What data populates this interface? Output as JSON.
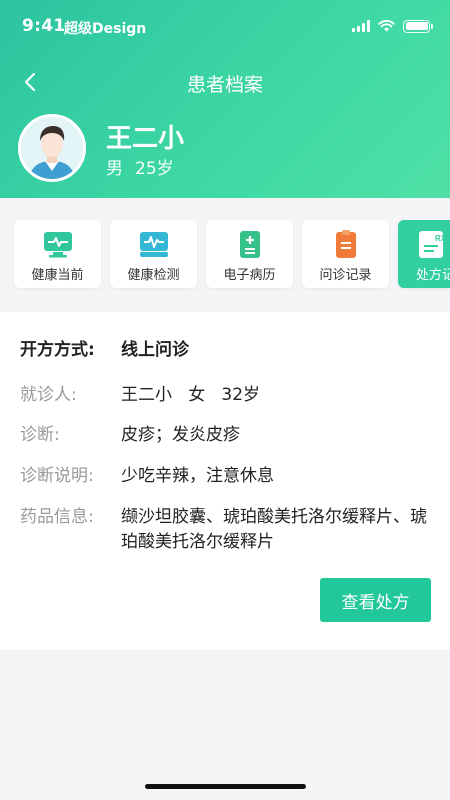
{
  "status_bar": {
    "time": "9:41",
    "carrier": "超级Design"
  },
  "nav": {
    "title": "患者档案"
  },
  "patient": {
    "name": "王二小",
    "gender": "男",
    "age": "25岁"
  },
  "quick_actions": [
    {
      "label": "健康当前",
      "icon": "monitor-heartbeat-icon",
      "color": "#2fc79b"
    },
    {
      "label": "健康检测",
      "icon": "pulse-screen-icon",
      "color": "#33b7d4"
    },
    {
      "label": "电子病历",
      "icon": "medical-record-icon",
      "color": "#35c28a"
    },
    {
      "label": "问诊记录",
      "icon": "consult-record-icon",
      "color": "#f07a3a"
    },
    {
      "label": "处方记",
      "icon": "prescription-icon",
      "color": "#ffffff",
      "active": true
    }
  ],
  "prescription": {
    "method_label": "开方方式:",
    "method": "线上问诊",
    "patient_label": "就诊人:",
    "patient": "王二小   女   32岁",
    "diagnosis_label": "诊断:",
    "diagnosis": "皮疹；发炎皮疹",
    "note_label": "诊断说明:",
    "note": "少吃辛辣，注意休息",
    "drug_label": "药品信息:",
    "drugs": "缬沙坦胶囊、琥珀酸美托洛尔缓释片、琥珀酸美托洛尔缓释片",
    "view_button": "查看处方"
  },
  "colors": {
    "header_start": "#2cc3a0",
    "header_end": "#4fe0a6",
    "accent": "#22c79a"
  }
}
